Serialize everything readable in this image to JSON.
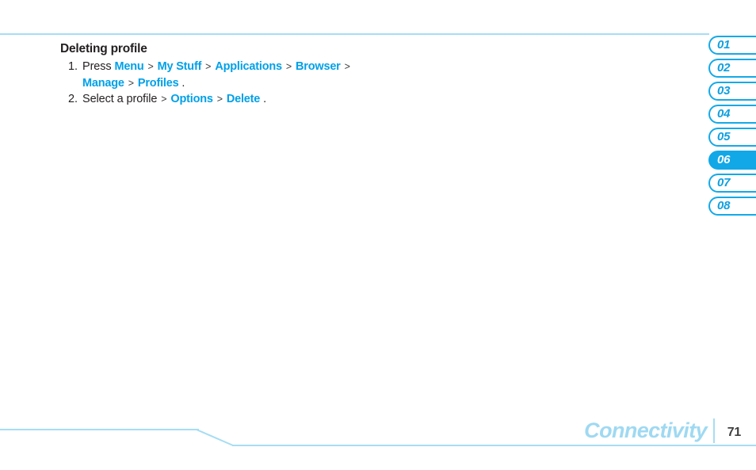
{
  "page": {
    "section_title": "Deleting profile",
    "steps": [
      {
        "number": "1.",
        "lead": "Press",
        "line1": [
          {
            "type": "kw",
            "text": "Menu"
          },
          {
            "type": "sep",
            "text": ">"
          },
          {
            "type": "kw",
            "text": "My Stuff"
          },
          {
            "type": "sep",
            "text": ">"
          },
          {
            "type": "kw",
            "text": "Applications"
          },
          {
            "type": "sep",
            "text": ">"
          },
          {
            "type": "kw",
            "text": "Browser"
          },
          {
            "type": "sep",
            "text": ">"
          }
        ],
        "line2": [
          {
            "type": "kw",
            "text": "Manage"
          },
          {
            "type": "sep",
            "text": ">"
          },
          {
            "type": "kw",
            "text": "Profiles"
          },
          {
            "type": "plain",
            "text": "."
          }
        ]
      },
      {
        "number": "2.",
        "lead": "Select a profile",
        "line1": [
          {
            "type": "sep",
            "text": ">"
          },
          {
            "type": "kw",
            "text": "Options"
          },
          {
            "type": "sep",
            "text": ">"
          },
          {
            "type": "kw",
            "text": "Delete"
          },
          {
            "type": "plain",
            "text": "."
          }
        ],
        "line2": []
      }
    ]
  },
  "chapter_tabs": [
    {
      "label": "01",
      "active": false
    },
    {
      "label": "02",
      "active": false
    },
    {
      "label": "03",
      "active": false
    },
    {
      "label": "04",
      "active": false
    },
    {
      "label": "05",
      "active": false
    },
    {
      "label": "06",
      "active": true
    },
    {
      "label": "07",
      "active": false
    },
    {
      "label": "08",
      "active": false
    }
  ],
  "footer": {
    "chapter_label": "Connectivity",
    "page_number": "71"
  },
  "colors": {
    "accent_blue": "#00a0e8",
    "tab_blue": "#12a8e8",
    "rule_blue": "#a6ddf4",
    "footer_label_blue": "#9fd9f2",
    "text_dark": "#231f20"
  }
}
